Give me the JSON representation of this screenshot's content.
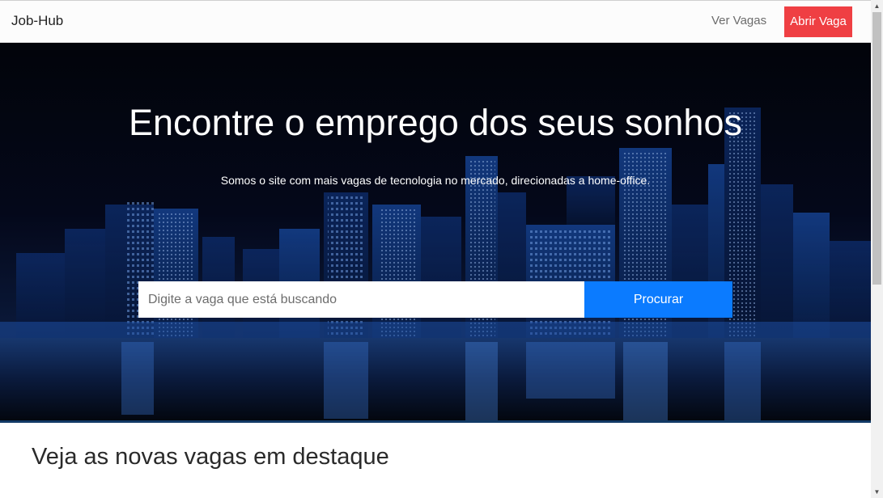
{
  "navbar": {
    "brand": "Job-Hub",
    "links": [
      {
        "label": "Ver Vagas"
      }
    ],
    "cta_label": "Abrir Vaga"
  },
  "hero": {
    "title": "Encontre o emprego dos seus sonhos",
    "subtitle": "Somos o site com mais vagas de tecnologia no mercado, direcionadas a home-office.",
    "search": {
      "placeholder": "Digite a vaga que está buscando",
      "value": "",
      "button_label": "Procurar"
    },
    "background_image": "city-skyline-night"
  },
  "featured": {
    "title": "Veja as novas vagas em destaque"
  },
  "colors": {
    "cta": "#ef3f43",
    "search_button": "#0b7bff",
    "hero_bg": "#03050d"
  },
  "icons": {
    "scroll_up": "chevron-up-icon",
    "scroll_down": "chevron-down-icon"
  }
}
